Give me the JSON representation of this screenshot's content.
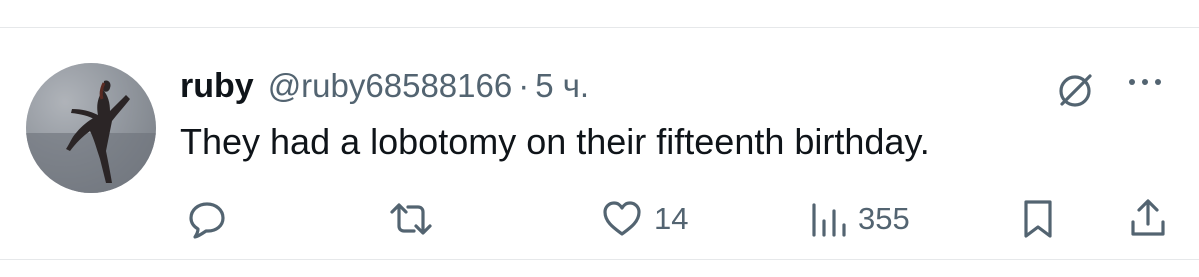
{
  "tweet": {
    "display_name": "ruby",
    "handle": "@ruby68588166",
    "separator": "·",
    "time": "5 ч.",
    "text": "They had a lobotomy on their fifteenth birthday."
  },
  "actions": {
    "reply_icon": "speech-bubble-icon",
    "repost_icon": "repost-arrows-icon",
    "like_icon": "heart-icon",
    "like_count": "14",
    "views_icon": "bar-chart-icon",
    "views_count": "355",
    "bookmark_icon": "bookmark-icon",
    "share_icon": "upload-arrow-icon"
  },
  "header_icons": {
    "grok_icon": "grok-slash-circle-icon",
    "more_icon": "three-dots-icon"
  },
  "colors": {
    "text_primary": "#0f1419",
    "text_secondary": "#536471",
    "divider": "#e6e8ea"
  }
}
